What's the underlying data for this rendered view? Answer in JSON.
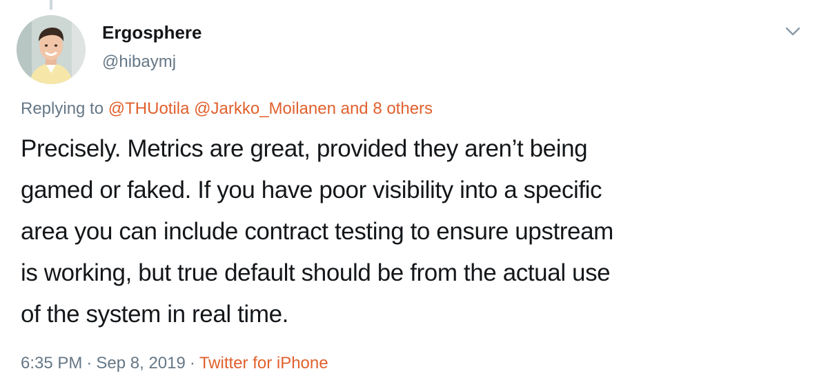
{
  "author": {
    "display_name": "Ergosphere",
    "handle": "@hibaymj"
  },
  "reply": {
    "prefix": "Replying to",
    "mention_1": "@THUotila",
    "mention_2": "@Jarkko_Moilanen",
    "others": "and 8 others"
  },
  "tweet": {
    "lines": [
      "Precisely. Metrics are great, provided they aren’t being",
      "gamed or faked. If you have poor visibility into a specific",
      "area you can include contract testing to ensure upstream",
      "is working, but true default should be from the actual use",
      "of the system in real time."
    ]
  },
  "meta": {
    "time": "6:35 PM",
    "separator": "·",
    "date": "Sep 8, 2019",
    "source": "Twitter for iPhone"
  },
  "icons": {
    "menu": "chevron-down-icon",
    "avatar": "avatar"
  },
  "colors": {
    "accent": "#e0602d",
    "muted": "#657786",
    "text": "#14171a"
  }
}
